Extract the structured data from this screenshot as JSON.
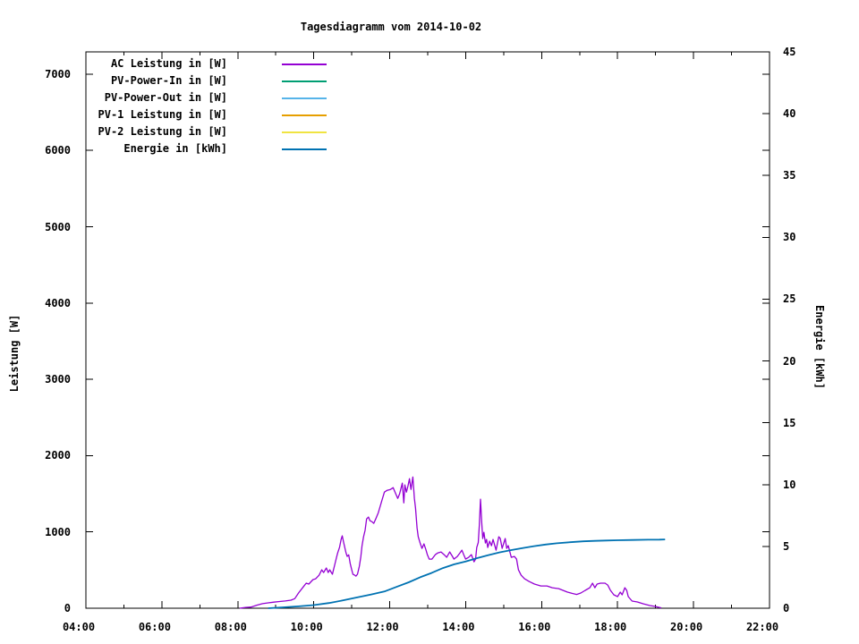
{
  "chart_data": {
    "type": "line",
    "title": "Tagesdiagramm vom 2014-10-02",
    "xlabel": "",
    "ylabel": "Leistung [W]",
    "y2label": "Energie [kWh]",
    "grid": false,
    "legend_position": "top-left-inside",
    "xlim_hours": [
      4,
      22
    ],
    "ylim": [
      0,
      7292
    ],
    "y2lim": [
      0,
      45
    ],
    "x_ticks_major": [
      {
        "hour": 4,
        "label": "04:00"
      },
      {
        "hour": 6,
        "label": "06:00"
      },
      {
        "hour": 8,
        "label": "08:00"
      },
      {
        "hour": 10,
        "label": "10:00"
      },
      {
        "hour": 12,
        "label": "12:00"
      },
      {
        "hour": 14,
        "label": "14:00"
      },
      {
        "hour": 16,
        "label": "16:00"
      },
      {
        "hour": 18,
        "label": "18:00"
      },
      {
        "hour": 20,
        "label": "20:00"
      },
      {
        "hour": 22,
        "label": "22:00"
      }
    ],
    "x_minor_hours": [
      5,
      7,
      9,
      11,
      13,
      15,
      17,
      19,
      21
    ],
    "y_ticks": [
      0,
      1000,
      2000,
      3000,
      4000,
      5000,
      6000,
      7000
    ],
    "y2_ticks": [
      0,
      5,
      10,
      15,
      20,
      25,
      30,
      35,
      40,
      45
    ],
    "series": [
      {
        "name": "AC Leistung in [W]",
        "color": "#9400d3",
        "axis": "y1",
        "points": [
          [
            8.05,
            0
          ],
          [
            8.2,
            10
          ],
          [
            8.35,
            15
          ],
          [
            8.5,
            40
          ],
          [
            8.65,
            60
          ],
          [
            8.8,
            70
          ],
          [
            8.95,
            80
          ],
          [
            9.1,
            88
          ],
          [
            9.25,
            95
          ],
          [
            9.4,
            105
          ],
          [
            9.5,
            125
          ],
          [
            9.6,
            200
          ],
          [
            9.74,
            290
          ],
          [
            9.8,
            328
          ],
          [
            9.87,
            316
          ],
          [
            9.98,
            375
          ],
          [
            10.05,
            386
          ],
          [
            10.14,
            433
          ],
          [
            10.21,
            503
          ],
          [
            10.26,
            468
          ],
          [
            10.33,
            527
          ],
          [
            10.38,
            468
          ],
          [
            10.42,
            503
          ],
          [
            10.49,
            445
          ],
          [
            10.56,
            585
          ],
          [
            10.6,
            667
          ],
          [
            10.63,
            726
          ],
          [
            10.68,
            800
          ],
          [
            10.72,
            900
          ],
          [
            10.75,
            948
          ],
          [
            10.79,
            855
          ],
          [
            10.85,
            726
          ],
          [
            10.88,
            679
          ],
          [
            10.92,
            700
          ],
          [
            10.96,
            585
          ],
          [
            11.0,
            503
          ],
          [
            11.03,
            445
          ],
          [
            11.08,
            433
          ],
          [
            11.11,
            421
          ],
          [
            11.15,
            445
          ],
          [
            11.2,
            550
          ],
          [
            11.24,
            679
          ],
          [
            11.27,
            819
          ],
          [
            11.31,
            937
          ],
          [
            11.35,
            1020
          ],
          [
            11.39,
            1170
          ],
          [
            11.44,
            1195
          ],
          [
            11.48,
            1147
          ],
          [
            11.53,
            1135
          ],
          [
            11.58,
            1112
          ],
          [
            11.64,
            1180
          ],
          [
            11.7,
            1252
          ],
          [
            11.79,
            1405
          ],
          [
            11.86,
            1522
          ],
          [
            11.93,
            1545
          ],
          [
            12.02,
            1557
          ],
          [
            12.09,
            1580
          ],
          [
            12.15,
            1510
          ],
          [
            12.21,
            1440
          ],
          [
            12.26,
            1500
          ],
          [
            12.33,
            1640
          ],
          [
            12.37,
            1381
          ],
          [
            12.4,
            1616
          ],
          [
            12.44,
            1522
          ],
          [
            12.48,
            1600
          ],
          [
            12.52,
            1697
          ],
          [
            12.56,
            1557
          ],
          [
            12.61,
            1720
          ],
          [
            12.65,
            1440
          ],
          [
            12.68,
            1311
          ],
          [
            12.72,
            1053
          ],
          [
            12.75,
            937
          ],
          [
            12.8,
            855
          ],
          [
            12.85,
            784
          ],
          [
            12.9,
            843
          ],
          [
            12.95,
            770
          ],
          [
            12.99,
            702
          ],
          [
            13.04,
            644
          ],
          [
            13.11,
            644
          ],
          [
            13.2,
            702
          ],
          [
            13.27,
            726
          ],
          [
            13.35,
            737
          ],
          [
            13.43,
            702
          ],
          [
            13.5,
            667
          ],
          [
            13.58,
            737
          ],
          [
            13.65,
            680
          ],
          [
            13.69,
            644
          ],
          [
            13.78,
            679
          ],
          [
            13.84,
            720
          ],
          [
            13.9,
            761
          ],
          [
            13.95,
            700
          ],
          [
            14.0,
            644
          ],
          [
            14.08,
            667
          ],
          [
            14.15,
            702
          ],
          [
            14.22,
            608
          ],
          [
            14.26,
            644
          ],
          [
            14.29,
            796
          ],
          [
            14.33,
            860
          ],
          [
            14.36,
            1089
          ],
          [
            14.39,
            1428
          ],
          [
            14.42,
            1135
          ],
          [
            14.45,
            913
          ],
          [
            14.48,
            995
          ],
          [
            14.52,
            855
          ],
          [
            14.55,
            901
          ],
          [
            14.58,
            796
          ],
          [
            14.63,
            878
          ],
          [
            14.68,
            819
          ],
          [
            14.72,
            901
          ],
          [
            14.8,
            761
          ],
          [
            14.87,
            937
          ],
          [
            14.91,
            913
          ],
          [
            14.96,
            784
          ],
          [
            15.04,
            913
          ],
          [
            15.08,
            784
          ],
          [
            15.12,
            819
          ],
          [
            15.2,
            667
          ],
          [
            15.28,
            679
          ],
          [
            15.34,
            644
          ],
          [
            15.39,
            503
          ],
          [
            15.46,
            433
          ],
          [
            15.55,
            386
          ],
          [
            15.67,
            351
          ],
          [
            15.81,
            316
          ],
          [
            15.98,
            292
          ],
          [
            16.14,
            292
          ],
          [
            16.28,
            269
          ],
          [
            16.45,
            257
          ],
          [
            16.68,
            211
          ],
          [
            16.8,
            195
          ],
          [
            16.92,
            180
          ],
          [
            17.03,
            199
          ],
          [
            17.15,
            234
          ],
          [
            17.27,
            269
          ],
          [
            17.34,
            328
          ],
          [
            17.4,
            269
          ],
          [
            17.46,
            316
          ],
          [
            17.55,
            328
          ],
          [
            17.67,
            328
          ],
          [
            17.74,
            304
          ],
          [
            17.81,
            234
          ],
          [
            17.9,
            176
          ],
          [
            18.0,
            152
          ],
          [
            18.07,
            211
          ],
          [
            18.12,
            176
          ],
          [
            18.19,
            269
          ],
          [
            18.24,
            234
          ],
          [
            18.28,
            152
          ],
          [
            18.38,
            94
          ],
          [
            18.52,
            82
          ],
          [
            18.68,
            58
          ],
          [
            18.85,
            35
          ],
          [
            18.99,
            23
          ],
          [
            19.15,
            5
          ]
        ]
      },
      {
        "name": "PV-Power-In in [W]",
        "color": "#009e73",
        "axis": "y1",
        "points": []
      },
      {
        "name": "PV-Power-Out in [W]",
        "color": "#56b4e9",
        "axis": "y1",
        "points": []
      },
      {
        "name": "PV-1 Leistung in [W]",
        "color": "#e69f00",
        "axis": "y1",
        "points": []
      },
      {
        "name": "PV-2 Leistung in [W]",
        "color": "#f0e442",
        "axis": "y1",
        "points": []
      },
      {
        "name": "Energie in [kWh]",
        "color": "#0072b2",
        "axis": "y2",
        "points": [
          [
            8.8,
            0
          ],
          [
            9.2,
            0.07
          ],
          [
            9.6,
            0.15
          ],
          [
            10.0,
            0.25
          ],
          [
            10.4,
            0.42
          ],
          [
            10.75,
            0.62
          ],
          [
            11.1,
            0.85
          ],
          [
            11.5,
            1.1
          ],
          [
            11.86,
            1.35
          ],
          [
            12.2,
            1.75
          ],
          [
            12.5,
            2.1
          ],
          [
            12.8,
            2.5
          ],
          [
            13.1,
            2.85
          ],
          [
            13.4,
            3.25
          ],
          [
            13.7,
            3.55
          ],
          [
            14.0,
            3.78
          ],
          [
            14.3,
            4.05
          ],
          [
            14.6,
            4.3
          ],
          [
            14.9,
            4.52
          ],
          [
            15.2,
            4.7
          ],
          [
            15.5,
            4.87
          ],
          [
            15.8,
            5.02
          ],
          [
            16.1,
            5.15
          ],
          [
            16.4,
            5.25
          ],
          [
            16.75,
            5.34
          ],
          [
            17.1,
            5.41
          ],
          [
            17.4,
            5.45
          ],
          [
            17.7,
            5.48
          ],
          [
            18.0,
            5.5
          ],
          [
            18.4,
            5.52
          ],
          [
            18.8,
            5.54
          ],
          [
            19.1,
            5.55
          ],
          [
            19.25,
            5.56
          ]
        ]
      }
    ]
  }
}
